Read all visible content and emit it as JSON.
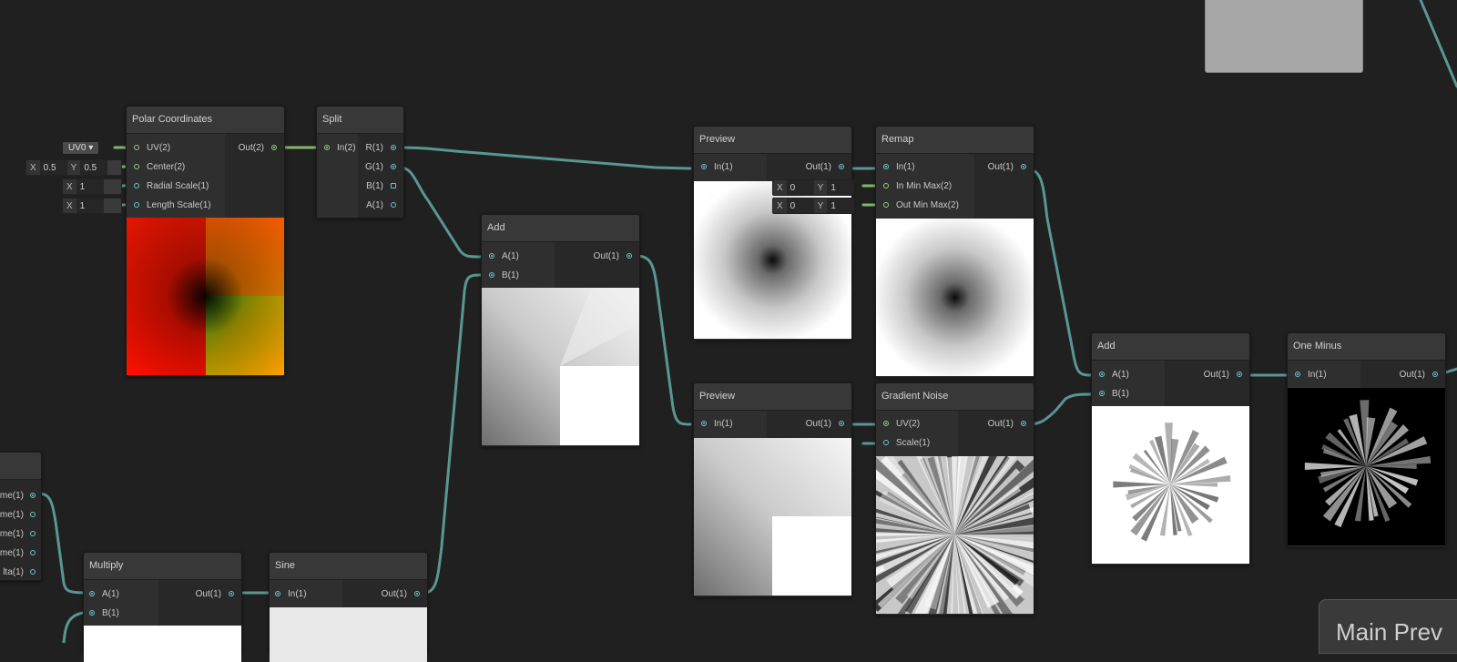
{
  "nodes": {
    "polar": {
      "title": "Polar Coordinates",
      "inputs": [
        "UV(2)",
        "Center(2)",
        "Radial Scale(1)",
        "Length Scale(1)"
      ],
      "outputs": [
        "Out(2)"
      ],
      "uv_dropdown": "UV0",
      "center": {
        "x_label": "X",
        "x": "0.5",
        "y_label": "Y",
        "y": "0.5"
      },
      "radial_scale": {
        "x_label": "X",
        "x": "1"
      },
      "length_scale": {
        "x_label": "X",
        "x": "1"
      }
    },
    "split": {
      "title": "Split",
      "inputs": [
        "In(2)"
      ],
      "outputs": [
        "R(1)",
        "G(1)",
        "B(1)",
        "A(1)"
      ]
    },
    "add1": {
      "title": "Add",
      "inputs": [
        "A(1)",
        "B(1)"
      ],
      "outputs": [
        "Out(1)"
      ]
    },
    "preview1": {
      "title": "Preview",
      "inputs": [
        "In(1)"
      ],
      "outputs": [
        "Out(1)"
      ]
    },
    "remap": {
      "title": "Remap",
      "inputs": [
        "In(1)",
        "In Min Max(2)",
        "Out Min Max(2)"
      ],
      "outputs": [
        "Out(1)"
      ],
      "in_min_max": {
        "x_label": "X",
        "x": "0",
        "y_label": "Y",
        "y": "1"
      },
      "out_min_max": {
        "x_label": "X",
        "x": "0",
        "y_label": "Y",
        "y": "1"
      }
    },
    "preview2": {
      "title": "Preview",
      "inputs": [
        "In(1)"
      ],
      "outputs": [
        "Out(1)"
      ]
    },
    "gradient_noise": {
      "title": "Gradient Noise",
      "inputs": [
        "UV(2)",
        "Scale(1)"
      ],
      "outputs": [
        "Out(1)"
      ]
    },
    "add2": {
      "title": "Add",
      "inputs": [
        "A(1)",
        "B(1)"
      ],
      "outputs": [
        "Out(1)"
      ]
    },
    "one_minus": {
      "title": "One Minus",
      "inputs": [
        "In(1)"
      ],
      "outputs": [
        "Out(1)"
      ]
    },
    "multiply": {
      "title": "Multiply",
      "inputs": [
        "A(1)",
        "B(1)"
      ],
      "outputs": [
        "Out(1)"
      ]
    },
    "sine": {
      "title": "Sine",
      "inputs": [
        "In(1)"
      ],
      "outputs": [
        "Out(1)"
      ]
    },
    "time": {
      "outputs": [
        "me(1)",
        "me(1)",
        "me(1)",
        "me(1)",
        "lta(1)"
      ]
    }
  },
  "main_preview_label": "Main Prev",
  "colors": {
    "wire_teal": "#5a9692",
    "wire_green": "#7fb86a",
    "port_teal": "#6bc6c8",
    "port_green": "#8fd27c"
  }
}
